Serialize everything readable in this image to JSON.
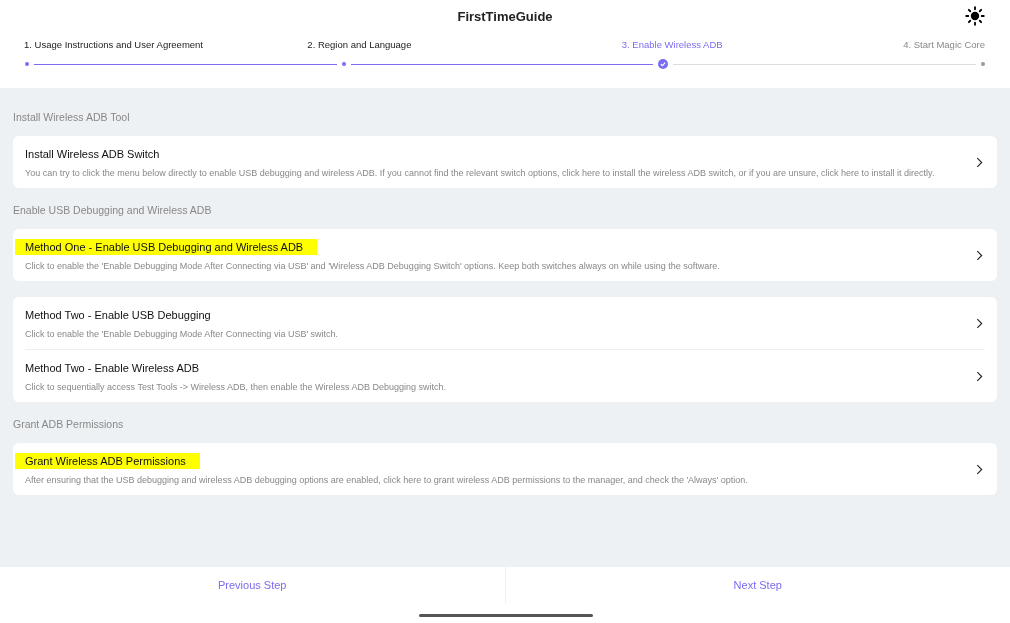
{
  "window": {
    "title": "FirstTimeGuide"
  },
  "steps": [
    {
      "label": "1. Usage Instructions and User Agreement",
      "completed": true,
      "selected": false
    },
    {
      "label": "2. Region and Language",
      "completed": true,
      "selected": false
    },
    {
      "label": "3. Enable Wireless ADB",
      "completed": false,
      "selected": true
    },
    {
      "label": "4. Start Magic Core",
      "completed": false,
      "selected": false
    }
  ],
  "sections": [
    {
      "title": "Install Wireless ADB Tool",
      "cards": [
        [
          {
            "title": "Install Wireless ADB Switch",
            "description": "You can try to click the menu below directly to enable USB debugging and wireless ADB. If you cannot find the relevant switch options, click here to install the wireless ADB switch, or if you are unsure, click here to install it directly.",
            "highlighted": false
          }
        ]
      ]
    },
    {
      "title": "Enable USB Debugging and Wireless ADB",
      "cards": [
        [
          {
            "title": "Method One - Enable USB Debugging and Wireless ADB",
            "description": "Click to enable the 'Enable Debugging Mode After Connecting via USB' and 'Wireless ADB Debugging Switch' options. Keep both switches always on while using the software.",
            "highlighted": true
          }
        ],
        [
          {
            "title": "Method Two - Enable USB Debugging",
            "description": "Click to enable the 'Enable Debugging Mode After Connecting via USB' switch.",
            "highlighted": false
          },
          {
            "title": "Method Two - Enable Wireless ADB",
            "description": "Click to sequentially access Test Tools -> Wireless ADB, then enable the Wireless ADB Debugging switch.",
            "highlighted": false
          }
        ]
      ]
    },
    {
      "title": "Grant ADB Permissions",
      "cards": [
        [
          {
            "title": "Grant Wireless ADB Permissions",
            "description": "After ensuring that the USB debugging and wireless ADB debugging options are enabled, click here to grant wireless ADB permissions to the manager, and check the 'Always' option.",
            "highlighted": true
          }
        ]
      ]
    }
  ],
  "footer": {
    "previous": "Previous Step",
    "next": "Next Step"
  }
}
